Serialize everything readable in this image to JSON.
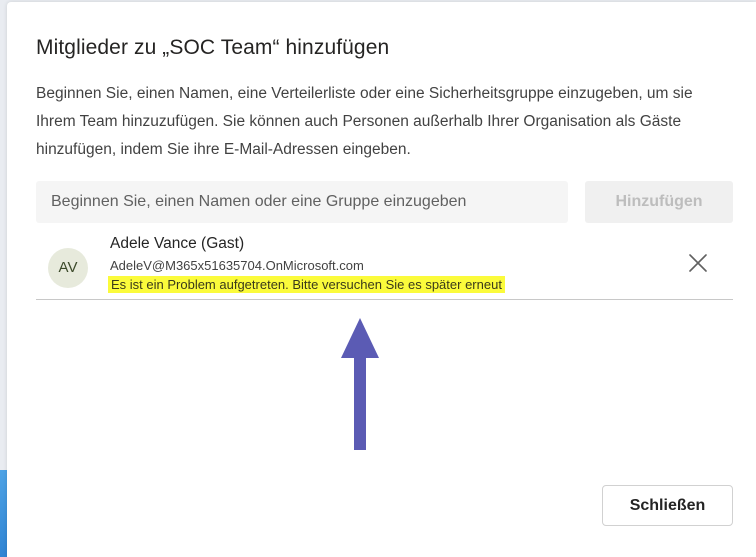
{
  "dialog": {
    "title": "Mitglieder zu „SOC Team“ hinzufügen",
    "description": "Beginnen Sie, einen Namen, eine Verteilerliste oder eine Sicherheitsgruppe einzugeben, um sie Ihrem Team hinzuzufügen. Sie können auch Personen außerhalb Ihrer Organisation als Gäste hinzufügen, indem Sie ihre E-Mail-Adressen eingeben."
  },
  "search": {
    "placeholder": "Beginnen Sie, einen Namen oder eine Gruppe einzugeben",
    "value": ""
  },
  "add_button": {
    "label": "Hinzufügen",
    "state": "disabled"
  },
  "member": {
    "initials": "AV",
    "name": "Adele Vance (Gast)",
    "email": "AdeleV@M365x51635704.OnMicrosoft.com",
    "error": "Es ist ein Problem aufgetreten. Bitte versuchen Sie es später erneut",
    "remove_icon": "close-icon"
  },
  "close_button": {
    "label": "Schließen"
  },
  "colors": {
    "highlight": "#fbfb3b",
    "arrow": "#5b5bb4",
    "avatar_bg": "#e7eadc",
    "accent": "#2b7fd0"
  }
}
